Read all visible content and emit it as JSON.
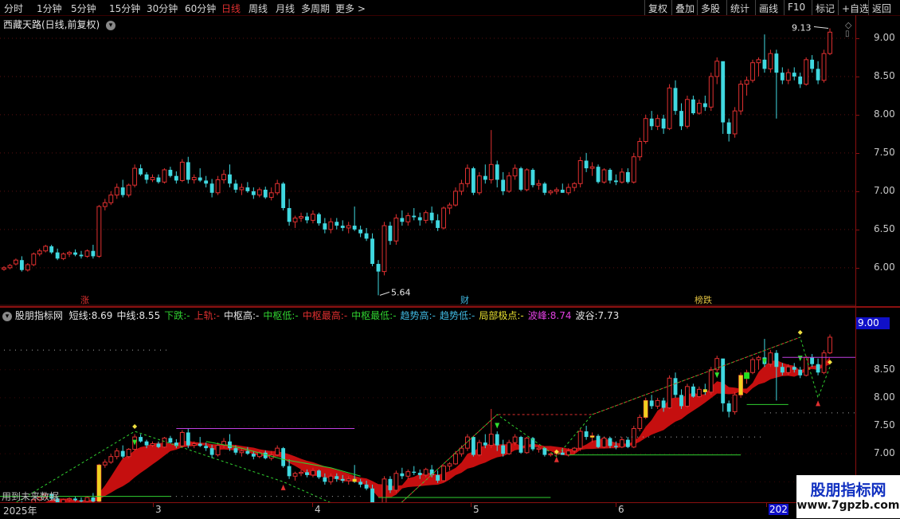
{
  "toolbar": {
    "left_tabs": [
      "分时",
      "1分钟",
      "5分钟",
      "15分钟",
      "30分钟",
      "60分钟",
      "日线",
      "周线",
      "月线",
      "多周期",
      "更多 >"
    ],
    "active_tab": "日线",
    "right_buttons": [
      "复权",
      "叠加",
      "多股",
      "统计",
      "画线",
      "F10",
      "标记",
      "+自选",
      "返回"
    ]
  },
  "main": {
    "title": "西藏天路(日线,前复权)",
    "high_label": "9.13",
    "low_label": "5.64",
    "event_tags": [
      "涨",
      "财",
      "榜跌"
    ]
  },
  "indicator": {
    "title": "股朋指标网",
    "legend": [
      {
        "label": "短线:",
        "value": "8.69",
        "color": "#e6e6e6"
      },
      {
        "label": "中线:",
        "value": "8.55",
        "color": "#e6e6e6"
      },
      {
        "label": "下跌:",
        "value": "-",
        "color": "#30d030"
      },
      {
        "label": "上轨:",
        "value": "-",
        "color": "#e03030"
      },
      {
        "label": "中枢高:",
        "value": "-",
        "color": "#e6e6e6"
      },
      {
        "label": "中枢低:",
        "value": "-",
        "color": "#30d030"
      },
      {
        "label": "中枢最高:",
        "value": "-",
        "color": "#e03030"
      },
      {
        "label": "中枢最低:",
        "value": "-",
        "color": "#30d030"
      },
      {
        "label": "趋势高:",
        "value": "-",
        "color": "#40b8e0"
      },
      {
        "label": "趋势低:",
        "value": "-",
        "color": "#40b8e0"
      },
      {
        "label": "局部极点:",
        "value": "-",
        "color": "#e8e030"
      },
      {
        "label": "波峰:",
        "value": "8.74",
        "color": "#e040e0"
      },
      {
        "label": "波谷:",
        "value": "7.73",
        "color": "#e6e6e6"
      }
    ],
    "current_value": "9.00",
    "no_future_text": "用到未来数据"
  },
  "axis_main": {
    "ticks": [
      "9.00",
      "8.50",
      "8.00",
      "7.50",
      "7.00",
      "6.50",
      "6.00"
    ]
  },
  "axis_ind": {
    "ticks": [
      "8.50",
      "8.00",
      "7.50",
      "7.00",
      "6.50"
    ]
  },
  "dates": {
    "labels": [
      "2025年",
      "3",
      "4",
      "5",
      "6",
      "202"
    ]
  },
  "watermark": {
    "line1": "股朋指标网",
    "line2": "www.7gpzb.com"
  },
  "colors": {
    "up": "#e03030",
    "down": "#40d8e0",
    "band": "#d01010",
    "accent": "#e03030"
  },
  "chart_data": {
    "type": "candlestick",
    "title": "西藏天路(日线,前复权)",
    "ylim": [
      5.55,
      9.25
    ],
    "candles": [
      [
        5.98,
        6.02,
        5.96,
        6.0
      ],
      [
        6.0,
        6.05,
        5.98,
        6.03
      ],
      [
        6.05,
        6.12,
        6.03,
        6.1
      ],
      [
        6.1,
        6.15,
        5.95,
        5.97
      ],
      [
        5.97,
        6.06,
        5.95,
        6.04
      ],
      [
        6.04,
        6.2,
        6.02,
        6.18
      ],
      [
        6.18,
        6.25,
        6.15,
        6.22
      ],
      [
        6.22,
        6.3,
        6.2,
        6.28
      ],
      [
        6.28,
        6.3,
        6.18,
        6.2
      ],
      [
        6.2,
        6.25,
        6.1,
        6.12
      ],
      [
        6.12,
        6.2,
        6.1,
        6.18
      ],
      [
        6.18,
        6.22,
        6.14,
        6.2
      ],
      [
        6.2,
        6.24,
        6.15,
        6.17
      ],
      [
        6.17,
        6.22,
        6.12,
        6.15
      ],
      [
        6.15,
        6.24,
        6.13,
        6.22
      ],
      [
        6.22,
        6.3,
        6.12,
        6.15
      ],
      [
        6.15,
        6.82,
        6.13,
        6.8
      ],
      [
        6.8,
        6.9,
        6.75,
        6.85
      ],
      [
        6.85,
        7.0,
        6.82,
        6.95
      ],
      [
        6.95,
        7.1,
        6.9,
        7.05
      ],
      [
        7.05,
        7.15,
        6.92,
        6.95
      ],
      [
        6.95,
        7.1,
        6.92,
        7.08
      ],
      [
        7.08,
        7.35,
        7.05,
        7.3
      ],
      [
        7.3,
        7.35,
        7.2,
        7.22
      ],
      [
        7.22,
        7.25,
        7.1,
        7.15
      ],
      [
        7.15,
        7.22,
        7.12,
        7.18
      ],
      [
        7.18,
        7.22,
        7.1,
        7.12
      ],
      [
        7.12,
        7.3,
        7.1,
        7.28
      ],
      [
        7.28,
        7.32,
        7.18,
        7.2
      ],
      [
        7.2,
        7.26,
        7.1,
        7.14
      ],
      [
        7.14,
        7.42,
        7.12,
        7.38
      ],
      [
        7.38,
        7.45,
        7.1,
        7.15
      ],
      [
        7.15,
        7.22,
        7.1,
        7.18
      ],
      [
        7.18,
        7.3,
        7.12,
        7.14
      ],
      [
        7.14,
        7.2,
        7.05,
        7.1
      ],
      [
        7.1,
        7.16,
        6.92,
        6.98
      ],
      [
        6.98,
        7.2,
        6.95,
        7.15
      ],
      [
        7.15,
        7.28,
        7.1,
        7.22
      ],
      [
        7.22,
        7.35,
        7.05,
        7.1
      ],
      [
        7.1,
        7.15,
        6.98,
        7.02
      ],
      [
        7.02,
        7.1,
        6.95,
        7.05
      ],
      [
        7.05,
        7.12,
        6.98,
        7.0
      ],
      [
        7.0,
        7.05,
        6.9,
        6.95
      ],
      [
        6.95,
        7.05,
        6.92,
        7.02
      ],
      [
        7.02,
        7.06,
        6.9,
        6.92
      ],
      [
        6.92,
        7.05,
        6.88,
        6.98
      ],
      [
        6.98,
        7.15,
        6.95,
        7.1
      ],
      [
        7.1,
        7.12,
        6.75,
        6.78
      ],
      [
        6.78,
        6.9,
        6.55,
        6.6
      ],
      [
        6.6,
        6.68,
        6.52,
        6.65
      ],
      [
        6.65,
        6.72,
        6.6,
        6.67
      ],
      [
        6.67,
        6.72,
        6.58,
        6.62
      ],
      [
        6.62,
        6.75,
        6.58,
        6.7
      ],
      [
        6.7,
        6.72,
        6.55,
        6.58
      ],
      [
        6.58,
        6.65,
        6.45,
        6.5
      ],
      [
        6.5,
        6.65,
        6.45,
        6.6
      ],
      [
        6.6,
        6.65,
        6.5,
        6.55
      ],
      [
        6.55,
        6.62,
        6.48,
        6.52
      ],
      [
        6.52,
        6.6,
        6.45,
        6.55
      ],
      [
        6.55,
        6.8,
        6.48,
        6.5
      ],
      [
        6.5,
        6.55,
        6.4,
        6.45
      ],
      [
        6.45,
        6.52,
        6.35,
        6.38
      ],
      [
        6.38,
        6.45,
        6.02,
        6.05
      ],
      [
        6.05,
        6.1,
        5.64,
        5.95
      ],
      [
        5.95,
        6.6,
        5.9,
        6.55
      ],
      [
        6.55,
        6.6,
        6.3,
        6.35
      ],
      [
        6.35,
        6.7,
        6.3,
        6.65
      ],
      [
        6.65,
        6.75,
        6.55,
        6.6
      ],
      [
        6.6,
        6.72,
        6.55,
        6.68
      ],
      [
        6.68,
        6.78,
        6.62,
        6.66
      ],
      [
        6.66,
        6.72,
        6.55,
        6.62
      ],
      [
        6.62,
        6.75,
        6.58,
        6.72
      ],
      [
        6.72,
        6.8,
        6.58,
        6.62
      ],
      [
        6.62,
        6.7,
        6.48,
        6.52
      ],
      [
        6.52,
        6.8,
        6.5,
        6.78
      ],
      [
        6.78,
        6.85,
        6.7,
        6.82
      ],
      [
        6.82,
        7.05,
        6.8,
        7.0
      ],
      [
        7.0,
        7.15,
        6.95,
        7.1
      ],
      [
        7.1,
        7.35,
        7.05,
        7.3
      ],
      [
        7.3,
        7.32,
        6.95,
        6.98
      ],
      [
        6.98,
        7.25,
        6.95,
        7.2
      ],
      [
        7.2,
        7.35,
        7.1,
        7.15
      ],
      [
        7.15,
        7.8,
        7.1,
        7.35
      ],
      [
        7.35,
        7.4,
        7.05,
        7.15
      ],
      [
        7.15,
        7.25,
        6.95,
        7.0
      ],
      [
        7.0,
        7.25,
        6.98,
        7.2
      ],
      [
        7.2,
        7.35,
        7.15,
        7.3
      ],
      [
        7.3,
        7.32,
        7.0,
        7.02
      ],
      [
        7.02,
        7.3,
        7.0,
        7.28
      ],
      [
        7.28,
        7.3,
        7.05,
        7.08
      ],
      [
        7.08,
        7.15,
        7.02,
        7.1
      ],
      [
        7.1,
        7.12,
        6.95,
        6.98
      ],
      [
        6.98,
        7.02,
        6.95,
        7.0
      ],
      [
        7.0,
        7.05,
        6.96,
        7.02
      ],
      [
        7.02,
        7.1,
        6.98,
        6.98
      ],
      [
        6.98,
        7.1,
        6.95,
        7.05
      ],
      [
        7.05,
        7.12,
        7.0,
        7.1
      ],
      [
        7.1,
        7.45,
        7.05,
        7.4
      ],
      [
        7.4,
        7.5,
        7.25,
        7.3
      ],
      [
        7.3,
        7.38,
        7.2,
        7.32
      ],
      [
        7.32,
        7.35,
        7.1,
        7.12
      ],
      [
        7.12,
        7.3,
        7.1,
        7.28
      ],
      [
        7.28,
        7.3,
        7.1,
        7.14
      ],
      [
        7.14,
        7.22,
        7.08,
        7.12
      ],
      [
        7.12,
        7.3,
        7.1,
        7.25
      ],
      [
        7.25,
        7.3,
        7.1,
        7.12
      ],
      [
        7.12,
        7.5,
        7.1,
        7.45
      ],
      [
        7.45,
        7.7,
        7.4,
        7.65
      ],
      [
        7.65,
        8.0,
        7.62,
        7.95
      ],
      [
        7.95,
        8.05,
        7.8,
        7.85
      ],
      [
        7.85,
        8.0,
        7.8,
        7.95
      ],
      [
        7.95,
        8.0,
        7.75,
        7.82
      ],
      [
        7.82,
        8.4,
        7.8,
        8.35
      ],
      [
        8.35,
        8.45,
        8.0,
        8.05
      ],
      [
        8.05,
        8.15,
        7.8,
        7.85
      ],
      [
        7.85,
        8.25,
        7.82,
        8.2
      ],
      [
        8.2,
        8.25,
        8.0,
        8.02
      ],
      [
        8.02,
        8.2,
        8.0,
        8.15
      ],
      [
        8.15,
        8.25,
        8.05,
        8.1
      ],
      [
        8.1,
        8.55,
        8.05,
        8.5
      ],
      [
        8.5,
        8.75,
        8.4,
        8.7
      ],
      [
        8.7,
        8.68,
        7.75,
        7.9
      ],
      [
        7.9,
        7.95,
        7.65,
        7.75
      ],
      [
        7.75,
        8.1,
        7.7,
        8.05
      ],
      [
        8.05,
        8.45,
        8.0,
        8.4
      ],
      [
        8.4,
        8.5,
        8.25,
        8.45
      ],
      [
        8.45,
        8.72,
        8.42,
        8.68
      ],
      [
        8.68,
        8.75,
        8.5,
        8.72
      ],
      [
        8.72,
        9.05,
        8.55,
        8.6
      ],
      [
        8.6,
        8.85,
        8.55,
        8.8
      ],
      [
        8.8,
        8.85,
        7.95,
        8.55
      ],
      [
        8.55,
        8.62,
        8.4,
        8.45
      ],
      [
        8.45,
        8.6,
        8.4,
        8.55
      ],
      [
        8.55,
        8.62,
        8.45,
        8.5
      ],
      [
        8.5,
        8.55,
        8.35,
        8.4
      ],
      [
        8.4,
        8.75,
        8.38,
        8.72
      ],
      [
        8.72,
        8.78,
        8.55,
        8.6
      ],
      [
        8.6,
        8.7,
        8.4,
        8.45
      ],
      [
        8.45,
        8.85,
        8.42,
        8.8
      ],
      [
        8.8,
        9.13,
        8.78,
        9.08
      ]
    ]
  }
}
